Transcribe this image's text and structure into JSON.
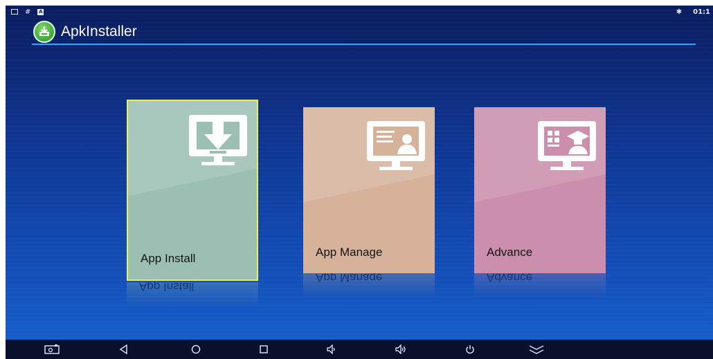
{
  "status_bar": {
    "left_icons": [
      "screen-icon",
      "hash-icon",
      "a-icon"
    ],
    "hash_symbol": "#",
    "a_symbol": "A",
    "bluetooth_symbol": "✱",
    "time": "01:1"
  },
  "app": {
    "title": "ApkInstaller",
    "logo_icon": "apk-installer-logo-icon",
    "accent_color": "#2aa5ff"
  },
  "tiles": [
    {
      "label": "App Install",
      "icon": "download-monitor-icon",
      "color": "#9cbfb4",
      "selected": true
    },
    {
      "label": "App Manage",
      "icon": "contact-card-icon",
      "color": "#d6b29b",
      "selected": false
    },
    {
      "label": "Advance",
      "icon": "grid-graduation-icon",
      "color": "#cb8eac",
      "selected": false
    }
  ],
  "nav_bar": {
    "buttons": [
      "screenshot-icon",
      "back-icon",
      "home-icon",
      "recents-icon",
      "volume-down-icon",
      "volume-up-icon",
      "power-icon",
      "collapse-icon"
    ]
  }
}
